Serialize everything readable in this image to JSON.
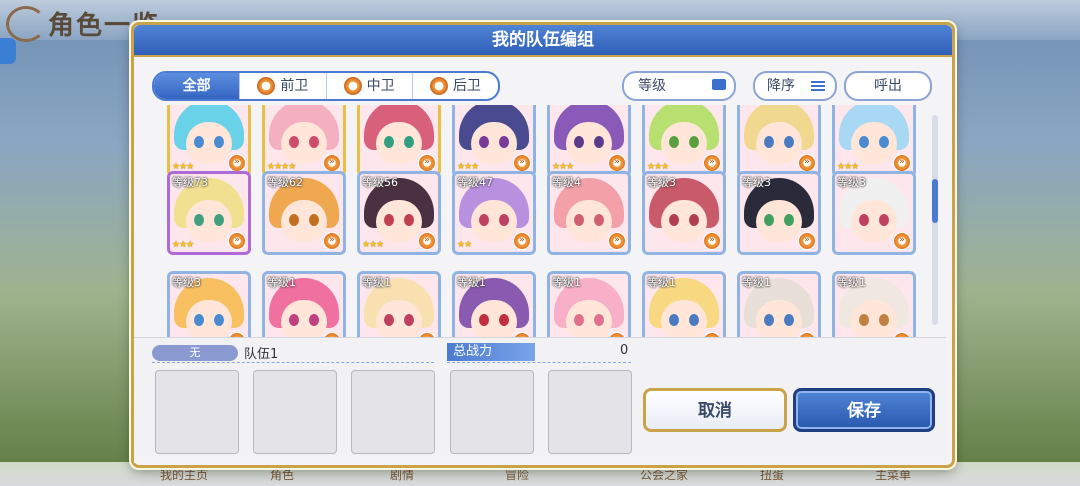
{
  "background": {
    "title": "角色一览",
    "bottom_tabs": [
      "我的主页",
      "角色",
      "剧情",
      "冒险",
      "公会之家",
      "扭蛋",
      "主菜单"
    ]
  },
  "dialog": {
    "title": "我的队伍编组",
    "tabs": [
      {
        "label": "全部",
        "active": true
      },
      {
        "label": "前卫",
        "active": false
      },
      {
        "label": "中卫",
        "active": false
      },
      {
        "label": "后卫",
        "active": false
      }
    ],
    "sort_field_label": "等级",
    "sort_order_label": "降序",
    "call_label": "呼出"
  },
  "roster": {
    "rows": [
      [
        {
          "level": "",
          "stars": "★★★",
          "frame": "gold",
          "hair": "#6ad2e8",
          "eye": "#4a8ad0"
        },
        {
          "level": "",
          "stars": "★★★★",
          "frame": "gold",
          "hair": "#f4b0c0",
          "eye": "#d04a6a"
        },
        {
          "level": "",
          "stars": "",
          "frame": "gold",
          "hair": "#d8607a",
          "eye": "#30a080"
        },
        {
          "level": "",
          "stars": "★★★",
          "frame": "blue",
          "hair": "#4a4a90",
          "eye": "#7a3a9a"
        },
        {
          "level": "",
          "stars": "★★★",
          "frame": "blue",
          "hair": "#8a5ab8",
          "eye": "#5a3a8a"
        },
        {
          "level": "",
          "stars": "★★★",
          "frame": "blue",
          "hair": "#b8e070",
          "eye": "#5aa040"
        },
        {
          "level": "",
          "stars": "",
          "frame": "blue",
          "hair": "#f0d890",
          "eye": "#4a7ac0"
        },
        {
          "level": "",
          "stars": "★★★",
          "frame": "blue",
          "hair": "#a8d8f4",
          "eye": "#4a8ad0"
        }
      ],
      [
        {
          "level": "等级73",
          "stars": "★★★",
          "frame": "purple",
          "hair": "#f0e090",
          "eye": "#40a080"
        },
        {
          "level": "等级62",
          "stars": "",
          "frame": "blue",
          "hair": "#f0a850",
          "eye": "#c07020"
        },
        {
          "level": "等级56",
          "stars": "★★★",
          "frame": "blue",
          "hair": "#4a3040",
          "eye": "#c04050"
        },
        {
          "level": "等级47",
          "stars": "★★",
          "frame": "blue",
          "hair": "#b890e0",
          "eye": "#c04060"
        },
        {
          "level": "等级4",
          "stars": "",
          "frame": "blue",
          "hair": "#f4a0a8",
          "eye": "#d06070"
        },
        {
          "level": "等级3",
          "stars": "",
          "frame": "blue",
          "hair": "#c85a6a",
          "eye": "#b04050"
        },
        {
          "level": "等级3",
          "stars": "",
          "frame": "blue",
          "hair": "#2a2a3a",
          "eye": "#40a060"
        },
        {
          "level": "等级3",
          "stars": "",
          "frame": "blue",
          "hair": "#f0f0f0",
          "eye": "#c04060"
        }
      ],
      [
        {
          "level": "等级3",
          "stars": "",
          "frame": "blue",
          "hair": "#f8c060",
          "eye": "#4a8ad0"
        },
        {
          "level": "等级1",
          "stars": "",
          "frame": "blue",
          "hair": "#f070a0",
          "eye": "#c04080"
        },
        {
          "level": "等级1",
          "stars": "",
          "frame": "blue",
          "hair": "#f8e0b0",
          "eye": "#c04060"
        },
        {
          "level": "等级1",
          "stars": "",
          "frame": "blue",
          "hair": "#8a5ab0",
          "eye": "#c03040"
        },
        {
          "level": "等级1",
          "stars": "",
          "frame": "blue",
          "hair": "#f8b0c8",
          "eye": "#e07090"
        },
        {
          "level": "等级1",
          "stars": "",
          "frame": "blue",
          "hair": "#f8d880",
          "eye": "#4a7ac0"
        },
        {
          "level": "等级1",
          "stars": "",
          "frame": "blue",
          "hair": "#e8e0d8",
          "eye": "#4a7ac0"
        },
        {
          "level": "等级1",
          "stars": "",
          "frame": "blue",
          "hair": "#f0e8e0",
          "eye": "#c08040"
        }
      ]
    ]
  },
  "team": {
    "none_badge": "无",
    "name": "队伍1",
    "power_label": "总战力",
    "power_value": "0",
    "slot_count": 5
  },
  "buttons": {
    "cancel": "取消",
    "save": "保存"
  },
  "colors": {
    "accent_blue": "#3565c2",
    "frame_gold": "#c9a24a"
  }
}
